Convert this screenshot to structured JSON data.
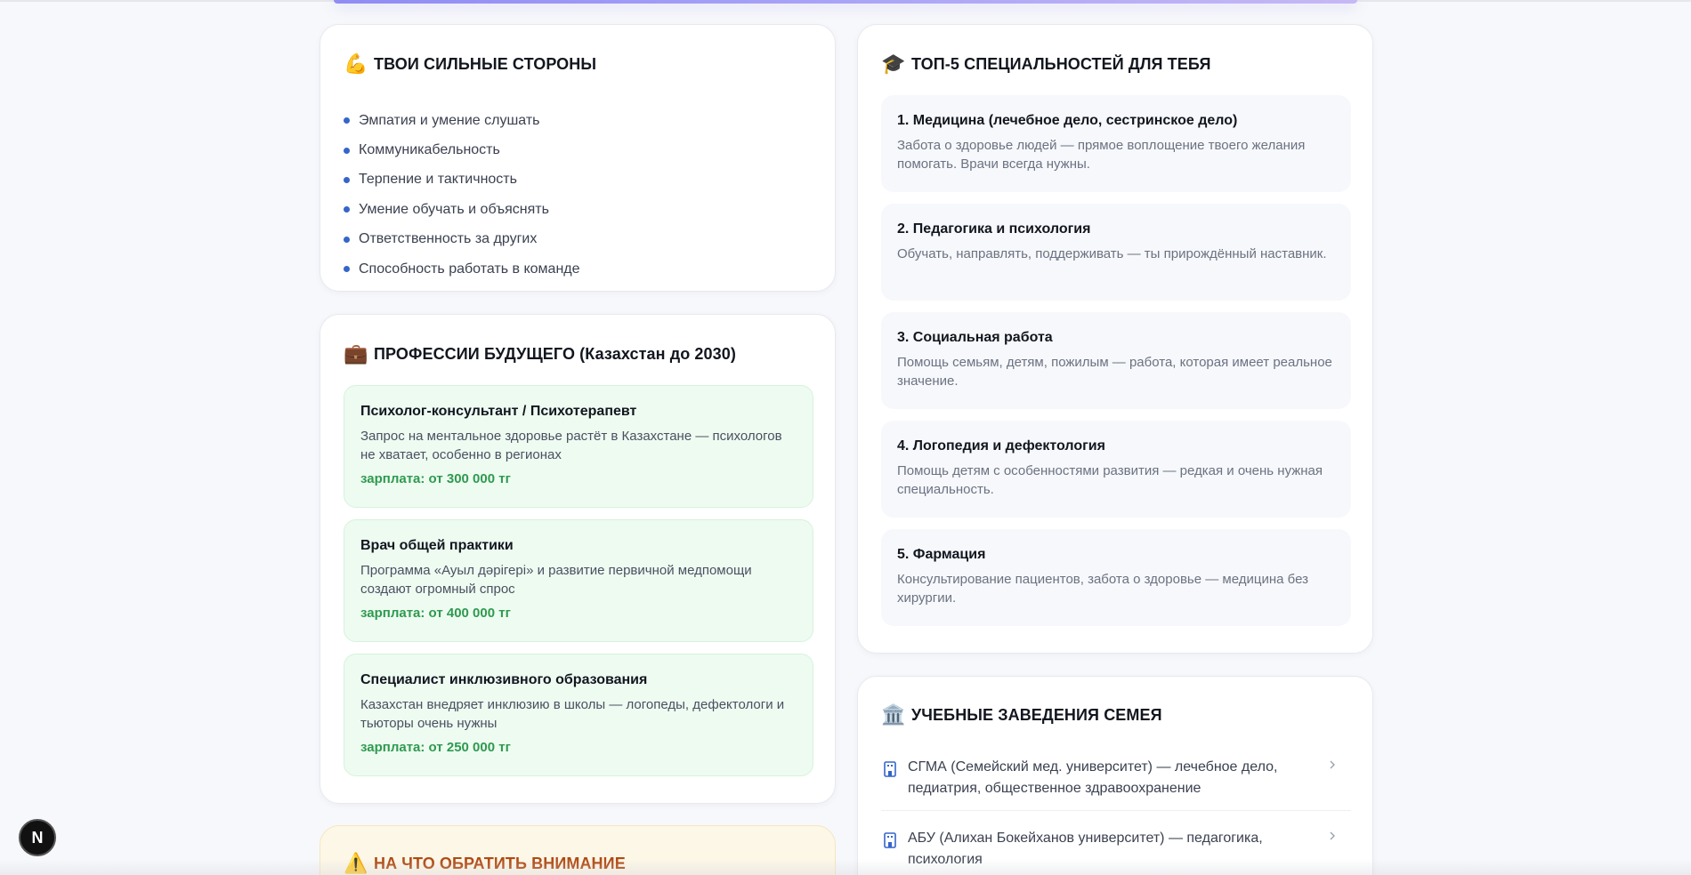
{
  "strengths": {
    "icon": "flexed-biceps-emoji",
    "emoji": "💪",
    "title": "ТВОИ СИЛЬНЫЕ СТОРОНЫ",
    "items": [
      "Эмпатия и умение слушать",
      "Коммуникабельность",
      "Терпение и тактичность",
      "Умение обучать и объяснять",
      "Ответственность за других",
      "Способность работать в команде"
    ]
  },
  "professions": {
    "icon": "briefcase-emoji",
    "emoji": "💼",
    "title": "ПРОФЕССИИ БУДУЩЕГО (Казахстан до 2030)",
    "items": [
      {
        "name": "Психолог-консультант / Психотерапевт",
        "desc": "Запрос на ментальное здоровье растёт в Казахстане — психологов не хватает, особенно в регионах",
        "salary": "зарплата: от 300 000 тг"
      },
      {
        "name": "Врач общей практики",
        "desc": "Программа «Ауыл дәрігері» и развитие первичной медпомощи создают огромный спрос",
        "salary": "зарплата: от 400 000 тг"
      },
      {
        "name": "Специалист инклюзивного образования",
        "desc": "Казахстан внедряет инклюзию в школы — логопеды, дефектологи и тьюторы очень нужны",
        "salary": "зарплата: от 250 000 тг"
      }
    ]
  },
  "specialties": {
    "icon": "graduation-cap-emoji",
    "emoji": "🎓",
    "title": "ТОП-5 СПЕЦИАЛЬНОСТЕЙ ДЛЯ ТЕБЯ",
    "items": [
      {
        "name": "1. Медицина (лечебное дело, сестринское дело)",
        "desc": "Забота о здоровье людей — прямое воплощение твоего желания помогать. Врачи всегда нужны."
      },
      {
        "name": "2. Педагогика и психология",
        "desc": "Обучать, направлять, поддерживать — ты прирождённый наставник."
      },
      {
        "name": "3. Социальная работа",
        "desc": "Помощь семьям, детям, пожилым — работа, которая имеет реальное значение."
      },
      {
        "name": "4. Логопедия и дефектология",
        "desc": "Помощь детям с особенностями развития — редкая и очень нужная специальность."
      },
      {
        "name": "5. Фармация",
        "desc": "Консультирование пациентов, забота о здоровье — медицина без хирургии."
      }
    ]
  },
  "institutions": {
    "icon": "classical-building-emoji",
    "emoji": "🏛️",
    "title": "УЧЕБНЫЕ ЗАВЕДЕНИЯ СЕМЕЯ",
    "items": [
      "СГМА (Семейский мед. университет) — лечебное дело, педиатрия, общественное здравоохранение",
      "АБУ (Алихан Бокейханов университет) — педагогика, психология"
    ]
  },
  "warning": {
    "icon": "warning-emoji",
    "emoji": "⚠️",
    "title": "НА ЧТО ОБРАТИТЬ ВНИМАНИЕ"
  },
  "dev_badge": {
    "label": "N"
  },
  "colors": {
    "accent_blue": "#3565c9",
    "salary_green": "#2e9a4f",
    "warning_text": "#b04a13"
  }
}
